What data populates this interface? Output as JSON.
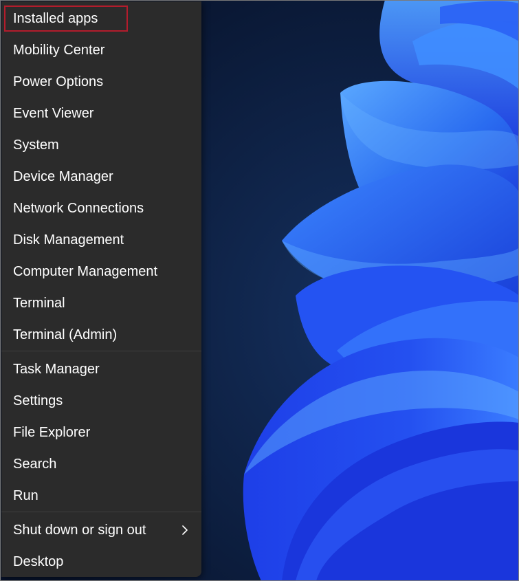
{
  "menu": {
    "group1": [
      {
        "name": "menu-item-installed-apps",
        "label": "Installed apps"
      },
      {
        "name": "menu-item-mobility-center",
        "label": "Mobility Center"
      },
      {
        "name": "menu-item-power-options",
        "label": "Power Options"
      },
      {
        "name": "menu-item-event-viewer",
        "label": "Event Viewer"
      },
      {
        "name": "menu-item-system",
        "label": "System"
      },
      {
        "name": "menu-item-device-manager",
        "label": "Device Manager"
      },
      {
        "name": "menu-item-network-connections",
        "label": "Network Connections"
      },
      {
        "name": "menu-item-disk-management",
        "label": "Disk Management"
      },
      {
        "name": "menu-item-computer-management",
        "label": "Computer Management"
      },
      {
        "name": "menu-item-terminal",
        "label": "Terminal"
      },
      {
        "name": "menu-item-terminal-admin",
        "label": "Terminal (Admin)"
      }
    ],
    "group2": [
      {
        "name": "menu-item-task-manager",
        "label": "Task Manager"
      },
      {
        "name": "menu-item-settings",
        "label": "Settings"
      },
      {
        "name": "menu-item-file-explorer",
        "label": "File Explorer"
      },
      {
        "name": "menu-item-search",
        "label": "Search"
      },
      {
        "name": "menu-item-run",
        "label": "Run"
      }
    ],
    "group3": [
      {
        "name": "menu-item-shut-down",
        "label": "Shut down or sign out",
        "submenu_icon": "chevron-right-icon"
      },
      {
        "name": "menu-item-desktop",
        "label": "Desktop"
      }
    ],
    "highlighted_item": "Installed apps",
    "colors": {
      "menu_background": "#2b2b2b",
      "text": "#ffffff",
      "highlight_border": "#b31c2c",
      "separator": "#3f3f3f"
    }
  },
  "wallpaper": {
    "description_icon": "windows-11-bloom-wallpaper",
    "colors": {
      "background": "#0b1a33",
      "bloom_light": "#3d8bff",
      "bloom_dark": "#1730e0"
    }
  }
}
